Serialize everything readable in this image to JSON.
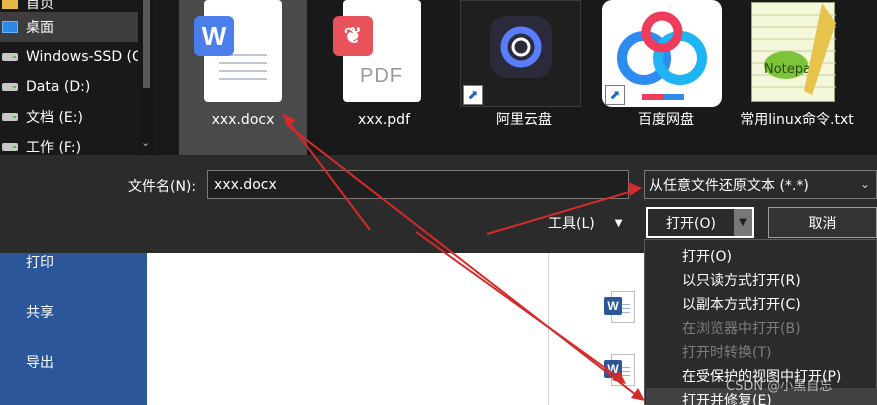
{
  "backstage": {
    "items": [
      {
        "label": "打印"
      },
      {
        "label": "共享"
      },
      {
        "label": "导出"
      }
    ]
  },
  "dialog": {
    "nav_items": [
      {
        "label": "桌面",
        "icon": "desktop-icon",
        "selected": true
      },
      {
        "label": "Windows-SSD (C:)",
        "icon": "drive-icon"
      },
      {
        "label": "Data (D:)",
        "icon": "drive-icon"
      },
      {
        "label": "文档 (E:)",
        "icon": "drive-icon"
      },
      {
        "label": "工作 (F:)",
        "icon": "drive-icon"
      }
    ],
    "files": [
      {
        "name": "xxx.docx",
        "type": "word-document",
        "selected": true
      },
      {
        "name": "xxx.pdf",
        "type": "pdf-document"
      },
      {
        "name": "阿里云盘",
        "type": "aliyun-drive-shortcut"
      },
      {
        "name": "百度网盘",
        "type": "baidu-netdisk-shortcut"
      },
      {
        "name": "常用linux命令.txt",
        "type": "notepadpp-text-file"
      }
    ],
    "pdf_icon_text": "PDF",
    "filename_label": "文件名(N):",
    "filename_value": "xxx.docx",
    "filter_value": "从任意文件还原文本 (*.*)",
    "tools_label": "工具(L)",
    "open_label": "打开(O)",
    "cancel_label": "取消",
    "open_menu": [
      {
        "label": "打开(O)",
        "enabled": true
      },
      {
        "label": "以只读方式打开(R)",
        "enabled": true
      },
      {
        "label": "以副本方式打开(C)",
        "enabled": true
      },
      {
        "label": "在浏览器中打开(B)",
        "enabled": false
      },
      {
        "label": "打开时转换(T)",
        "enabled": false
      },
      {
        "label": "在受保护的视图中打开(P)",
        "enabled": true
      },
      {
        "label": "打开并修复(E)",
        "enabled": true,
        "highlighted": true
      }
    ]
  },
  "watermark": "CSDN @小黑自忘",
  "colors": {
    "annotation_arrow": "#d42a2a",
    "word_blue": "#2b579a",
    "dialog_bg": "#2b2b2b"
  }
}
